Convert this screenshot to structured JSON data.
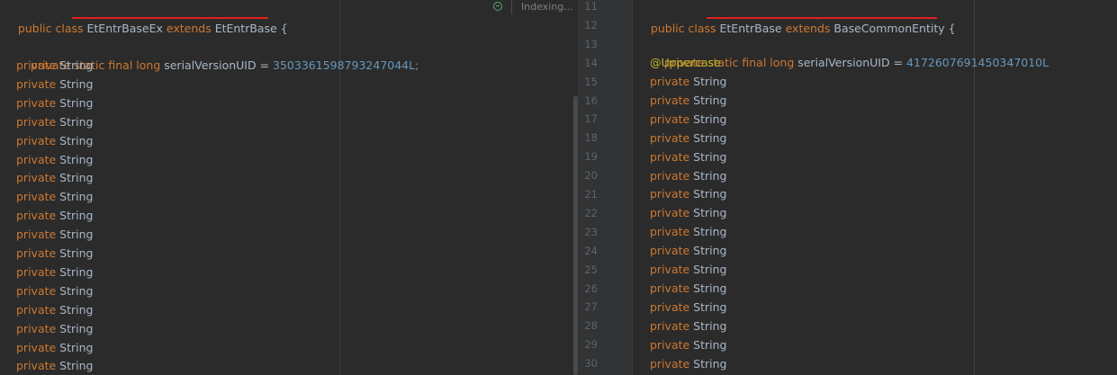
{
  "left_editor": {
    "class_decl": {
      "kw_public_class": "public class ",
      "class_name": "EtEntrBaseEx",
      "kw_extends": " extends ",
      "parent": "EtEntrBase",
      "brace": " {"
    },
    "serial": {
      "kw": "private static final long ",
      "name": "serialVersionUID = ",
      "value": "3503361598793247044L;"
    },
    "field_kw": "private ",
    "field_type": "String",
    "field_count_label": "17",
    "status": {
      "indexing": "Indexing..."
    }
  },
  "right_editor": {
    "line_numbers": [
      "11",
      "12",
      "13",
      "14",
      "15",
      "16",
      "17",
      "18",
      "19",
      "20",
      "21",
      "22",
      "23",
      "24",
      "25",
      "26",
      "27",
      "28",
      "29",
      "30"
    ],
    "class_decl": {
      "kw_public_class": "public class ",
      "class_name": "EtEntrBase",
      "kw_extends": " extends ",
      "parent": "BaseCommonEntity",
      "brace": " {"
    },
    "serial": {
      "kw": "private static final long ",
      "name": "serialVersionUID = ",
      "value": "4172607691450347010L"
    },
    "annotation": "@Uppercase",
    "field_kw": "private ",
    "field_type": "String"
  }
}
